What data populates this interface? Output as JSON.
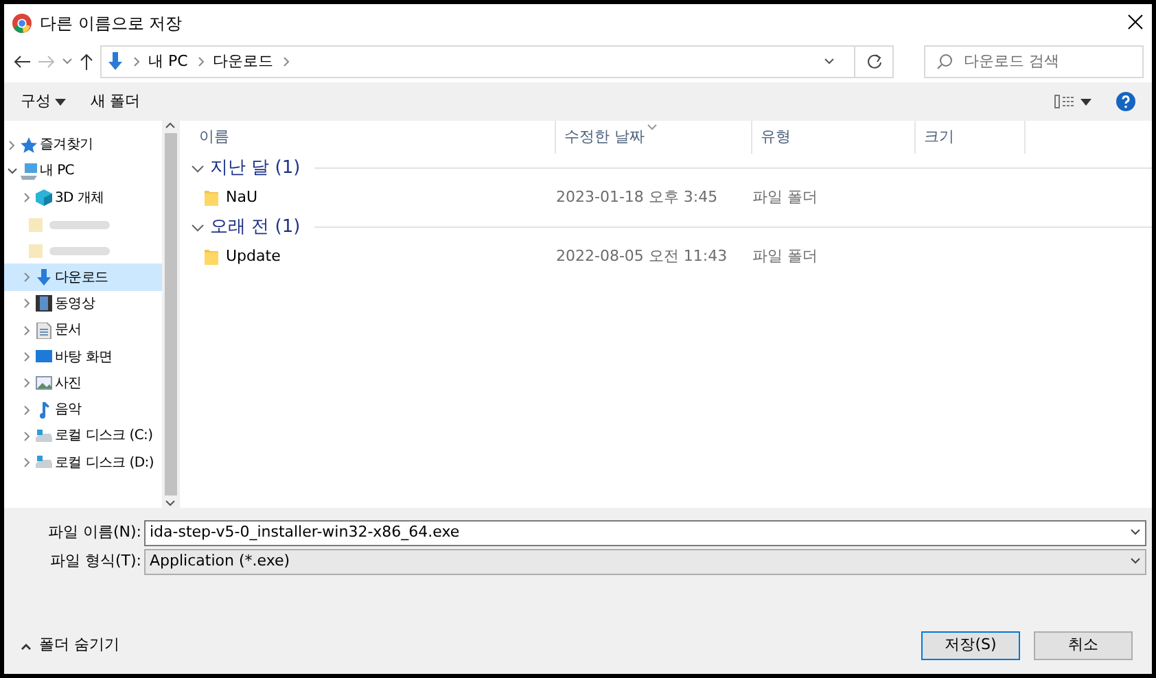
{
  "window": {
    "title": "다른 이름으로 저장"
  },
  "address": {
    "crumbs": [
      "내 PC",
      "다운로드"
    ]
  },
  "search": {
    "placeholder": "다운로드 검색"
  },
  "toolbar": {
    "organize": "구성",
    "new_folder": "새 폴더"
  },
  "sidebar": {
    "items": [
      {
        "label": "즐겨찾기",
        "expanded": false,
        "selected": false
      },
      {
        "label": "내 PC",
        "expanded": true,
        "selected": false,
        "children": [
          {
            "kind": "item",
            "label": "3D 개체",
            "selected": false
          },
          {
            "kind": "blurred"
          },
          {
            "kind": "blurred"
          },
          {
            "kind": "item",
            "label": "다운로드",
            "selected": true
          },
          {
            "kind": "item",
            "label": "동영상",
            "selected": false
          },
          {
            "kind": "item",
            "label": "문서",
            "selected": false
          },
          {
            "kind": "item",
            "label": "바탕 화면",
            "selected": false
          },
          {
            "kind": "item",
            "label": "사진",
            "selected": false
          },
          {
            "kind": "item",
            "label": "음악",
            "selected": false
          },
          {
            "kind": "item",
            "label": "로컬 디스크 (C:)",
            "selected": false
          },
          {
            "kind": "item",
            "label": "로컬 디스크 (D:)",
            "selected": false
          }
        ]
      }
    ]
  },
  "table": {
    "columns": [
      "이름",
      "수정한 날짜",
      "유형",
      "크기"
    ],
    "groups": [
      {
        "label": "지난 달 (1)",
        "expanded": true,
        "rows": [
          {
            "name": "NaU",
            "modified": "2023-01-18 오후 3:45",
            "type": "파일 폴더"
          }
        ]
      },
      {
        "label": "오래 전 (1)",
        "expanded": true,
        "rows": [
          {
            "name": "Update",
            "modified": "2022-08-05 오전 11:43",
            "type": "파일 폴더"
          }
        ]
      }
    ]
  },
  "filename": {
    "label": "파일 이름(N):",
    "value": "ida-step-v5-0_installer-win32-x86_64.exe"
  },
  "filetype": {
    "label": "파일 형식(T):",
    "value": "Application (*.exe)"
  },
  "hide_folders": "폴더 숨기기",
  "buttons": [
    {
      "label": "저장(S)",
      "kind": "primary"
    },
    {
      "label": "취소",
      "kind": "default"
    }
  ]
}
